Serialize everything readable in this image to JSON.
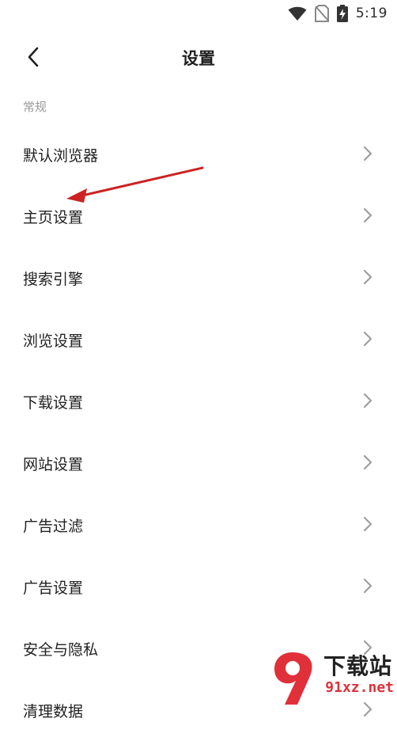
{
  "status_bar": {
    "time": "5:19",
    "icons": [
      "wifi-icon",
      "no-sim-icon",
      "battery-charging-icon"
    ]
  },
  "app_bar": {
    "title": "设置",
    "back_icon": "chevron-left-icon"
  },
  "section": {
    "header": "常规"
  },
  "settings_items": [
    {
      "label": "默认浏览器"
    },
    {
      "label": "主页设置"
    },
    {
      "label": "搜索引擎"
    },
    {
      "label": "浏览设置"
    },
    {
      "label": "下载设置"
    },
    {
      "label": "网站设置"
    },
    {
      "label": "广告过滤"
    },
    {
      "label": "广告设置"
    },
    {
      "label": "安全与隐私"
    },
    {
      "label": "清理数据"
    }
  ],
  "watermark": {
    "brand": "下载站",
    "domain": "91xz.net",
    "logo_text": "9"
  },
  "colors": {
    "annotation_arrow": "#cc2222",
    "watermark_red": "#e0303a",
    "section_header": "#9a9a9a",
    "chevron": "#9e9e9e"
  }
}
